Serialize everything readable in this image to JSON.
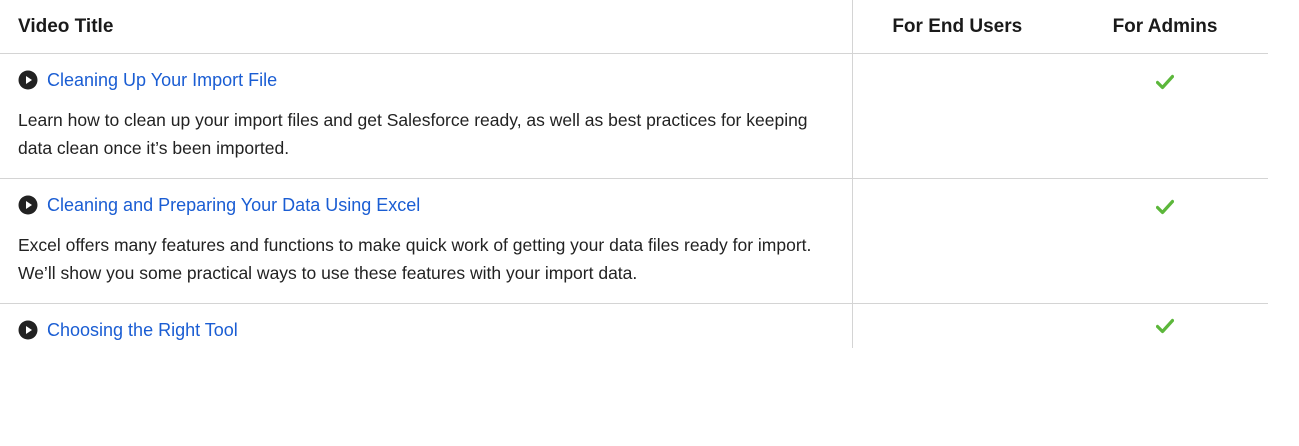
{
  "table": {
    "headers": {
      "title": "Video Title",
      "end_users": "For End Users",
      "admins": "For Admins"
    },
    "rows": [
      {
        "title": "Cleaning Up Your Import File",
        "description": "Learn how to clean up your import files and get Salesforce ready, as well as best practices for keeping data clean once it’s been imported.",
        "for_end_users": false,
        "for_admins": true
      },
      {
        "title": "Cleaning and Preparing Your Data Using Excel",
        "description": "Excel offers many features and functions to make quick work of getting your data files ready for import. We’ll show you some practical ways to use these features with your import data.",
        "for_end_users": false,
        "for_admins": true
      },
      {
        "title": "Choosing the Right Tool",
        "description": "",
        "for_end_users": false,
        "for_admins": true
      }
    ]
  },
  "icons": {
    "play": "play-circle-icon",
    "check": "checkmark-icon"
  },
  "colors": {
    "link": "#1a5dd3",
    "check": "#5cb73b",
    "border": "#d4d4d4",
    "play_circle": "#222222"
  }
}
